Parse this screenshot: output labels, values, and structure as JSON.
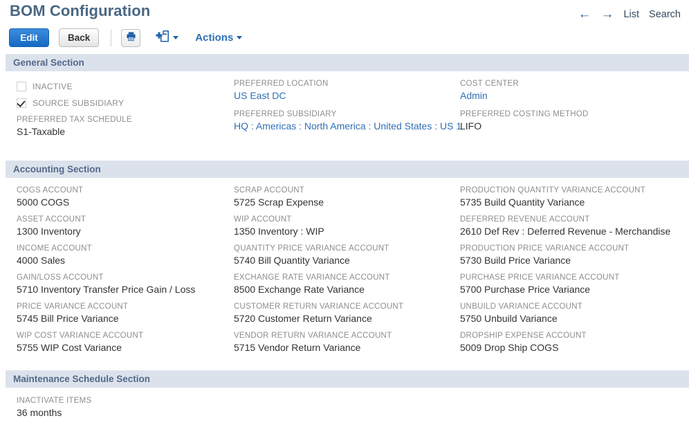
{
  "header": {
    "title": "BOM Configuration",
    "nav": {
      "back_arrow": "←",
      "forward_arrow": "→",
      "list_label": "List",
      "search_label": "Search"
    }
  },
  "toolbar": {
    "edit_label": "Edit",
    "back_label": "Back",
    "print_icon": "printer-icon",
    "new_doc_icon": "new-document-icon",
    "actions_label": "Actions"
  },
  "sections": [
    {
      "id": "general",
      "title": "General Section",
      "checkboxes": [
        {
          "label": "INACTIVE",
          "checked": false
        },
        {
          "label": "SOURCE SUBSIDIARY",
          "checked": true
        }
      ],
      "columns": [
        {
          "fields": [
            {
              "label": "PREFERRED TAX SCHEDULE",
              "value": "S1-Taxable",
              "link": false
            }
          ]
        },
        {
          "fields": [
            {
              "label": "PREFERRED LOCATION",
              "value": "US East DC",
              "link": true
            },
            {
              "label": "PREFERRED SUBSIDIARY",
              "value": "HQ : Americas : North America : United States : US 1",
              "link": true
            }
          ]
        },
        {
          "fields": [
            {
              "label": "COST CENTER",
              "value": "Admin",
              "link": true
            },
            {
              "label": "PREFERRED COSTING METHOD",
              "value": "LIFO",
              "link": false
            }
          ]
        }
      ]
    },
    {
      "id": "accounting",
      "title": "Accounting Section",
      "columns": [
        {
          "fields": [
            {
              "label": "COGS ACCOUNT",
              "value": "5000 COGS",
              "link": false
            },
            {
              "label": "ASSET ACCOUNT",
              "value": "1300 Inventory",
              "link": false
            },
            {
              "label": "INCOME ACCOUNT",
              "value": "4000 Sales",
              "link": false
            },
            {
              "label": "GAIN/LOSS ACCOUNT",
              "value": "5710 Inventory Transfer Price Gain / Loss",
              "link": false
            },
            {
              "label": "PRICE VARIANCE ACCOUNT",
              "value": "5745 Bill Price Variance",
              "link": false
            },
            {
              "label": "WIP COST VARIANCE ACCOUNT",
              "value": "5755 WIP Cost Variance",
              "link": false
            }
          ]
        },
        {
          "fields": [
            {
              "label": "SCRAP ACCOUNT",
              "value": "5725 Scrap Expense",
              "link": false
            },
            {
              "label": "WIP ACCOUNT",
              "value": "1350 Inventory : WIP",
              "link": false
            },
            {
              "label": "QUANTITY PRICE VARIANCE ACCOUNT",
              "value": "5740 Bill Quantity Variance",
              "link": false
            },
            {
              "label": "EXCHANGE RATE VARIANCE ACCOUNT",
              "value": "8500 Exchange Rate Variance",
              "link": false
            },
            {
              "label": "CUSTOMER RETURN VARIANCE ACCOUNT",
              "value": "5720 Customer Return Variance",
              "link": false
            },
            {
              "label": "VENDOR RETURN VARIANCE ACCOUNT",
              "value": "5715 Vendor Return Variance",
              "link": false
            }
          ]
        },
        {
          "fields": [
            {
              "label": "PRODUCTION QUANTITY VARIANCE ACCOUNT",
              "value": "5735 Build Quantity Variance",
              "link": false
            },
            {
              "label": "DEFERRED REVENUE ACCOUNT",
              "value": "2610 Def Rev : Deferred Revenue - Merchandise",
              "link": false
            },
            {
              "label": "PRODUCTION PRICE VARIANCE ACCOUNT",
              "value": "5730 Build Price Variance",
              "link": false
            },
            {
              "label": "PURCHASE PRICE VARIANCE ACCOUNT",
              "value": "5700 Purchase Price Variance",
              "link": false
            },
            {
              "label": "UNBUILD VARIANCE ACCOUNT",
              "value": "5750 Unbuild Variance",
              "link": false
            },
            {
              "label": "DROPSHIP EXPENSE ACCOUNT",
              "value": "5009 Drop Ship COGS",
              "link": false
            }
          ]
        }
      ]
    },
    {
      "id": "maintenance",
      "title": "Maintenance Schedule Section",
      "columns": [
        {
          "fields": [
            {
              "label": "INACTIVATE ITEMS",
              "value": "36 months",
              "link": false
            }
          ]
        },
        {
          "fields": []
        },
        {
          "fields": []
        }
      ]
    }
  ],
  "colors": {
    "title": "#4a6784",
    "band": "#dce2ec",
    "band_text": "#53688a",
    "link": "#2f6fb5",
    "label": "#8d8d8d",
    "value": "#333333",
    "primary_button": "#1769c4"
  }
}
